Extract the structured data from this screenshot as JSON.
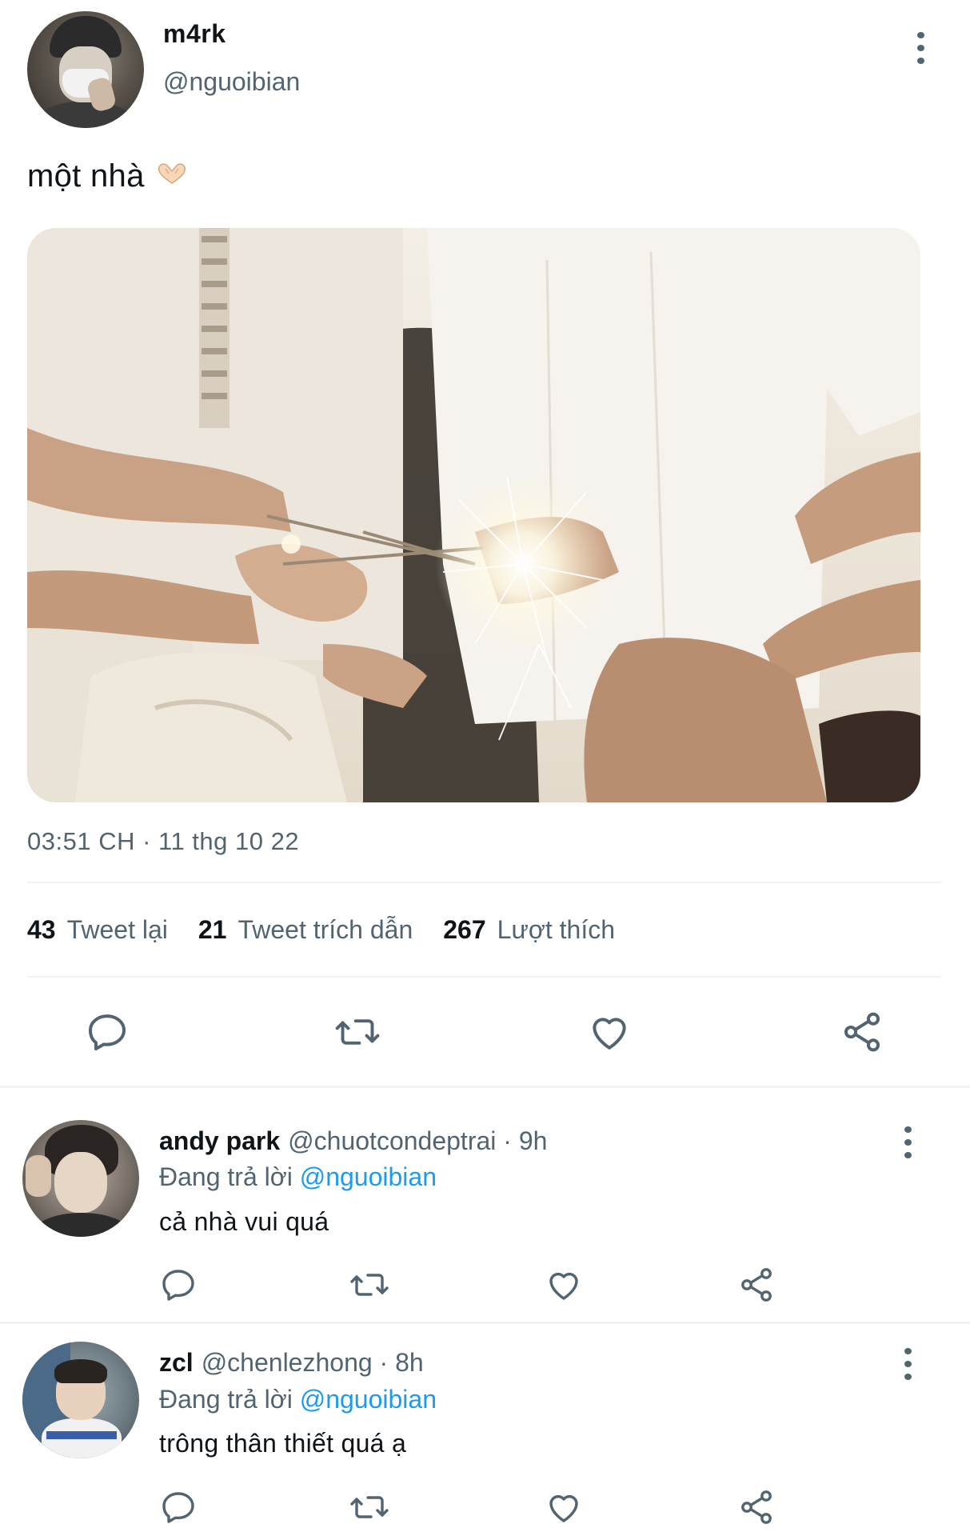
{
  "main_tweet": {
    "display_name": "m4rk",
    "handle": "@nguoibian",
    "text": "một nhà",
    "emoji_icon": "heart-hands-icon",
    "timestamp": "03:51 CH · 11 thg 10 22",
    "stats": [
      {
        "count": "43",
        "label": "Tweet lại"
      },
      {
        "count": "21",
        "label": "Tweet trích dẫn"
      },
      {
        "count": "267",
        "label": "Lượt thích"
      }
    ],
    "actions": [
      "reply-icon",
      "retweet-icon",
      "like-icon",
      "share-icon"
    ]
  },
  "replies": [
    {
      "display_name": "andy park",
      "handle": "@chuotcondeptrai",
      "time": "· 9h",
      "replying_prefix": "Đang trả lời",
      "replying_to": "@nguoibian",
      "text": "cả nhà vui quá"
    },
    {
      "display_name": "zcl",
      "handle": "@chenlezhong",
      "time": "· 8h",
      "replying_prefix": "Đang trả lời",
      "replying_to": "@nguoibian",
      "text": "trông thân thiết quá ạ"
    }
  ],
  "colors": {
    "text_primary": "#0f1419",
    "text_secondary": "#536471",
    "link": "#1d9bf0",
    "divider": "#eff3f4"
  }
}
